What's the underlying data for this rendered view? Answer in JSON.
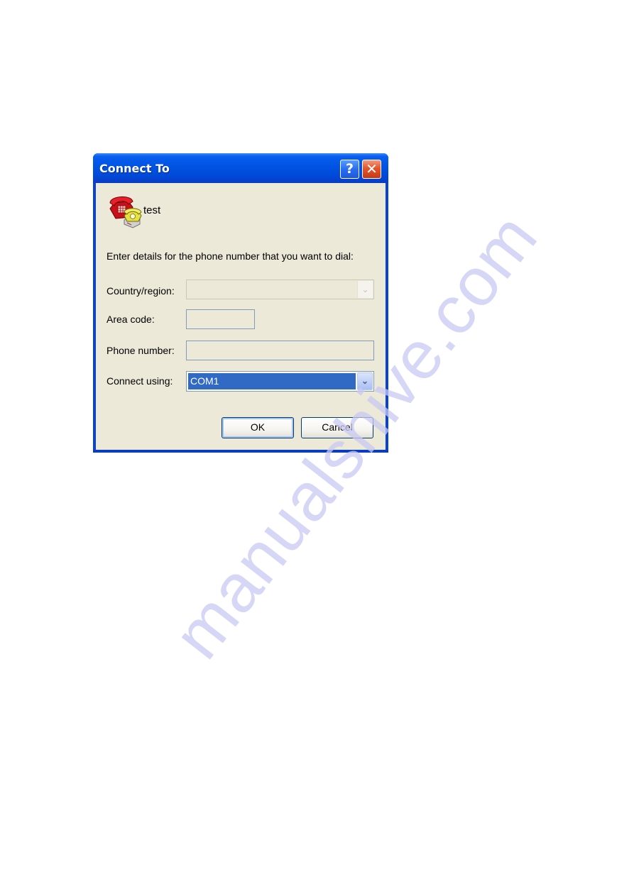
{
  "dialog": {
    "title": "Connect To",
    "title_buttons": {
      "help_glyph": "?",
      "close_glyph": "✕"
    },
    "connection_name": "test",
    "connection_icon": "phone-icon",
    "instruction": "Enter details for the phone number that you want to dial:",
    "fields": {
      "country_region": {
        "label": "Country/region:",
        "value": "",
        "state": "disabled"
      },
      "area_code": {
        "label": "Area code:",
        "value": "",
        "state": "disabled"
      },
      "phone_number": {
        "label": "Phone number:",
        "value": "",
        "state": "disabled"
      },
      "connect_using": {
        "label": "Connect using:",
        "value": "COM1",
        "state": "selected"
      }
    },
    "buttons": {
      "ok": "OK",
      "cancel": "Cancel"
    },
    "arrow_glyph": "⌄"
  },
  "watermark": "manualshive.com",
  "colors": {
    "titlebar": "#0054e3",
    "client_bg": "#ece9d8",
    "selection": "#316ac5",
    "close_button": "#e4552c",
    "watermark": "#c9c9f3"
  }
}
